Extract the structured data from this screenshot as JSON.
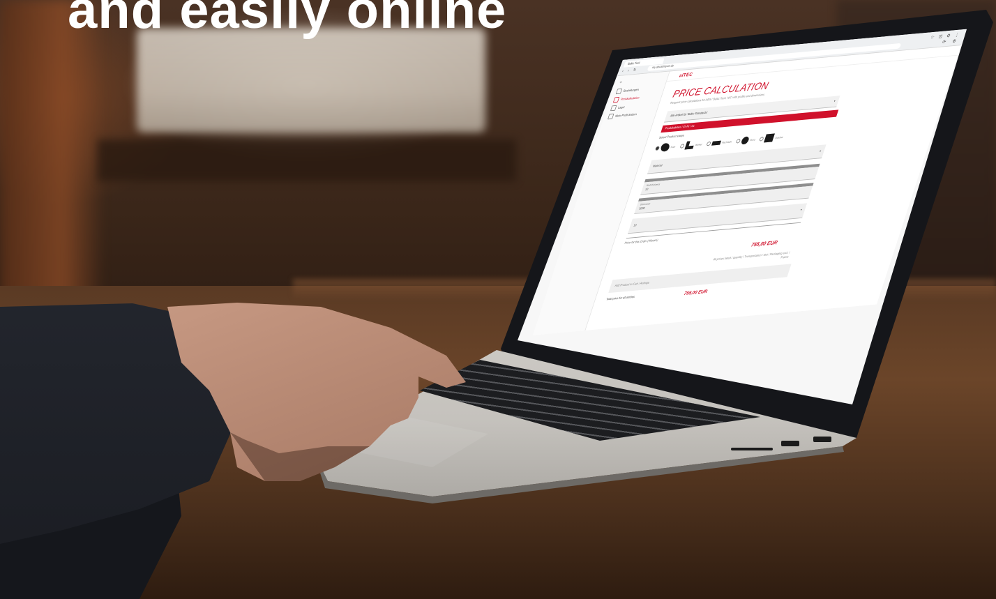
{
  "headline": "and easily online",
  "browser": {
    "tab_title": "Baltic Tool",
    "address": "my.abcatimport.de",
    "nav_icons": "‹ › ↻",
    "toolbar_icons": "☆ ⊡ ⚙ ⋮",
    "toolbar_icons_2": "⟳ ⊕"
  },
  "sidebar": {
    "collapse": "«",
    "items": [
      {
        "label": "Bestellungen"
      },
      {
        "label": "Preiskalkulation"
      },
      {
        "label": "Lager"
      },
      {
        "label": "Mein Profil ändern"
      }
    ]
  },
  "app": {
    "brand": "alTEC",
    "title": "PRICE CALCULATION",
    "subtitle": "Request price calculations for ABS / Baltic Tech, NIC with profile and dimensions",
    "select_value": "Alle Artikel für 'Baltic Standards'",
    "red_bar_text": "Produktdaten / ID-Nr / 01",
    "product_label": "Select Product shape",
    "products": [
      {
        "label": "Rohr",
        "shape": "tube"
      },
      {
        "label": "Winkel",
        "shape": "angle"
      },
      {
        "label": "Flachstahl",
        "shape": "flat"
      },
      {
        "label": "Rund",
        "shape": "circle"
      },
      {
        "label": "Quadrat",
        "shape": "square"
      }
    ],
    "fields": [
      {
        "label": "",
        "value": "Material"
      },
      {
        "label": "Wall thickness",
        "value": "10"
      },
      {
        "label": "Dimension",
        "value": "3000"
      },
      {
        "label": "",
        "value": "10"
      }
    ],
    "note": "Price for this Order (Wissen)",
    "price": "755,00 EUR",
    "price_note": "All prices listed / quantity / Transportation / Net / Packaging excl. / Frame",
    "box_text": "Add Product to Cart / Anfrage",
    "total_label": "Total price for all articles",
    "total": "755,00 EUR"
  },
  "colors": {
    "accent": "#d0112b",
    "headline": "#ffffff"
  }
}
